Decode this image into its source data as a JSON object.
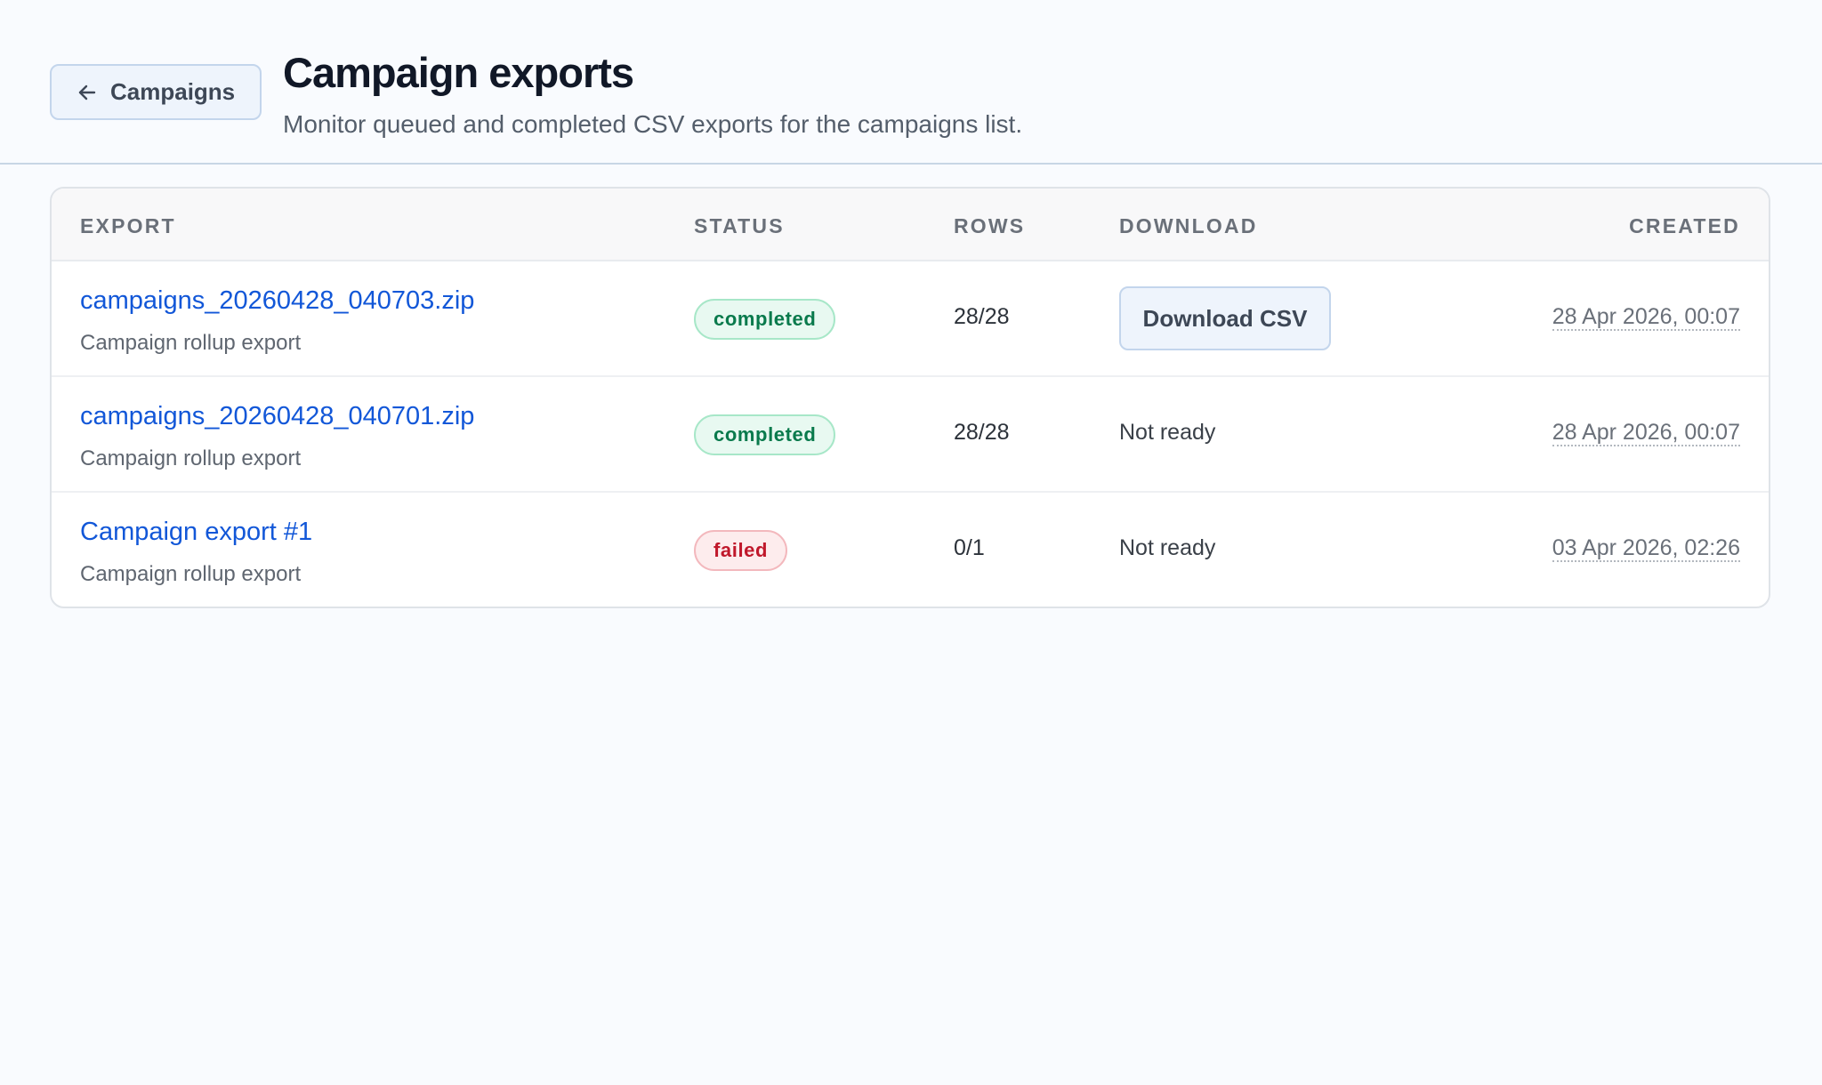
{
  "header": {
    "back_label": "Campaigns",
    "title": "Campaign exports",
    "subtitle": "Monitor queued and completed CSV exports for the campaigns list."
  },
  "table": {
    "columns": {
      "export": "EXPORT",
      "status": "STATUS",
      "rows": "ROWS",
      "download": "DOWNLOAD",
      "created": "CREATED"
    },
    "rows": [
      {
        "name": "campaigns_20260428_040703.zip",
        "description": "Campaign rollup export",
        "status": "completed",
        "rows": "28/28",
        "download": "Download CSV",
        "created": "28 Apr 2026, 00:07"
      },
      {
        "name": "campaigns_20260428_040701.zip",
        "description": "Campaign rollup export",
        "status": "completed",
        "rows": "28/28",
        "download": "Not ready",
        "created": "28 Apr 2026, 00:07"
      },
      {
        "name": "Campaign export #1",
        "description": "Campaign rollup export",
        "status": "failed",
        "rows": "0/1",
        "download": "Not ready",
        "created": "03 Apr 2026, 02:26"
      }
    ]
  },
  "icons": {
    "back": "arrow-left-icon"
  },
  "colors": {
    "link": "#1257d8",
    "completed": "#097a4c",
    "failed": "#c0182b",
    "background": "#f9fbfe"
  }
}
